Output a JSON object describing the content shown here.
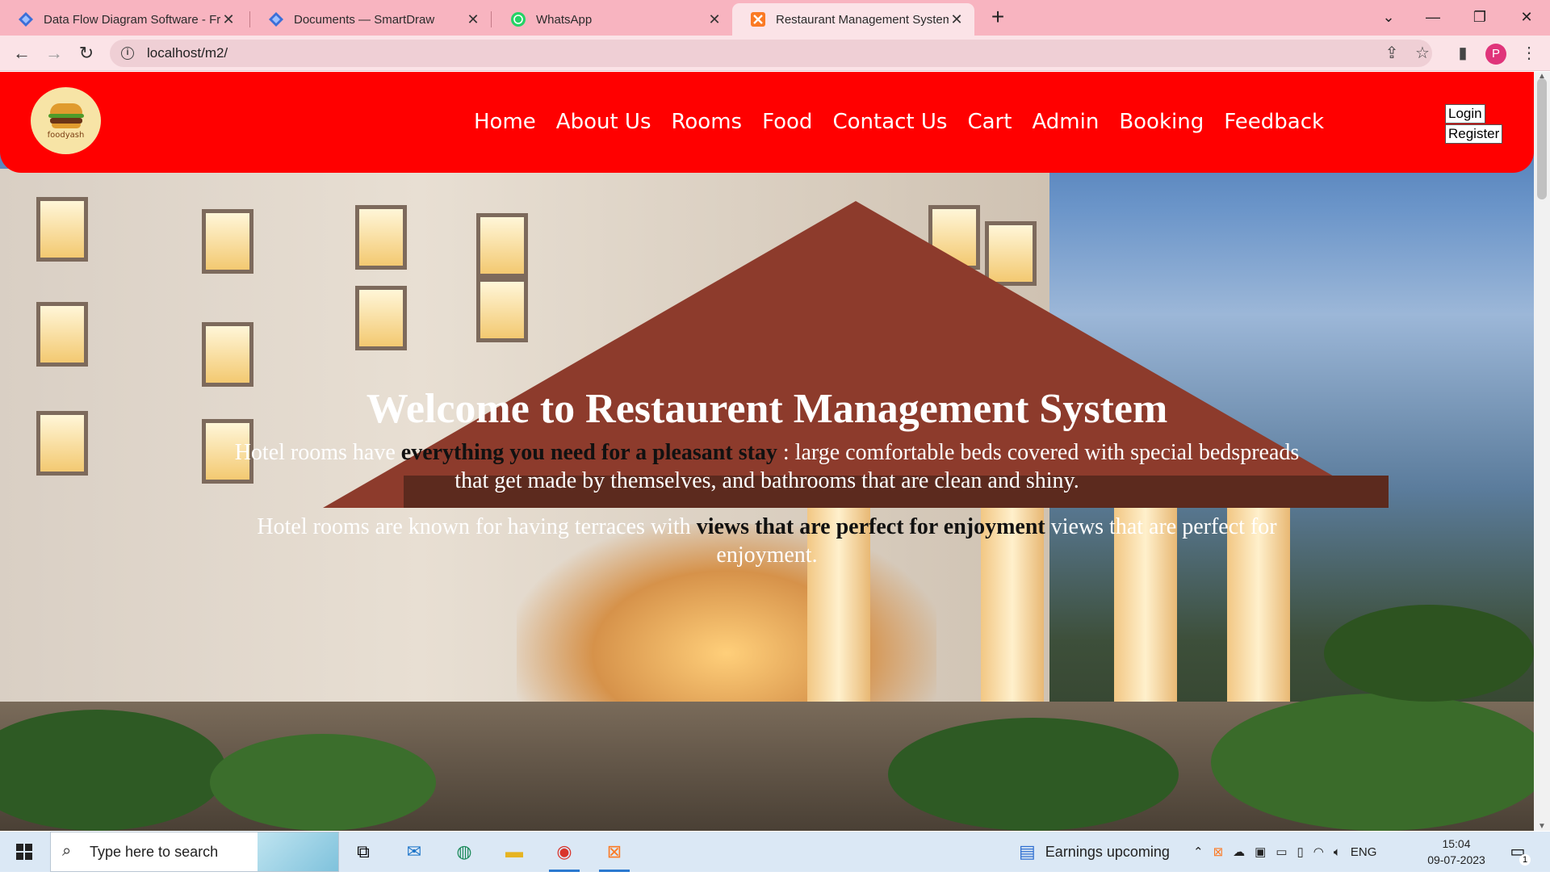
{
  "browser": {
    "tabs": [
      {
        "title": "Data Flow Diagram Software - Fr",
        "icon": "smartdraw-icon"
      },
      {
        "title": "Documents — SmartDraw",
        "icon": "smartdraw-icon"
      },
      {
        "title": "WhatsApp",
        "icon": "whatsapp-icon"
      },
      {
        "title": "Restaurant Management System",
        "icon": "xampp-icon",
        "active": true
      }
    ],
    "close_glyph": "✕",
    "new_tab_glyph": "+",
    "url": "localhost/m2/",
    "profile_initial": "P",
    "tabbar_color": "#f8b4c0",
    "toolbar_color": "#fbe3e7"
  },
  "site": {
    "logo_text": "foodyash",
    "nav": [
      "Home",
      "About Us",
      "Rooms",
      "Food",
      "Contact Us",
      "Cart",
      "Admin",
      "Booking",
      "Feedback"
    ],
    "auth": {
      "login": "Login",
      "register": "Register"
    },
    "navbar_color": "#ff0000",
    "hero": {
      "title": "Welcome to Restaurent Management System",
      "p1_before": "Hotel rooms have ",
      "p1_dark": "everything you need for a pleasant stay",
      "p1_after": " : large comfortable beds covered with special bedspreads that get made by themselves, and bathrooms that are clean and shiny.",
      "p2_before": "Hotel rooms are known for having terraces with ",
      "p2_dark": "views that are perfect for enjoyment",
      "p2_after": " views that are perfect for enjoyment."
    }
  },
  "taskbar": {
    "search_placeholder": "Type here to search",
    "weather": "Earnings upcoming",
    "lang": "ENG",
    "time": "15:04",
    "date": "09-07-2023",
    "notification_count": "1",
    "color": "#dbe8f5"
  }
}
